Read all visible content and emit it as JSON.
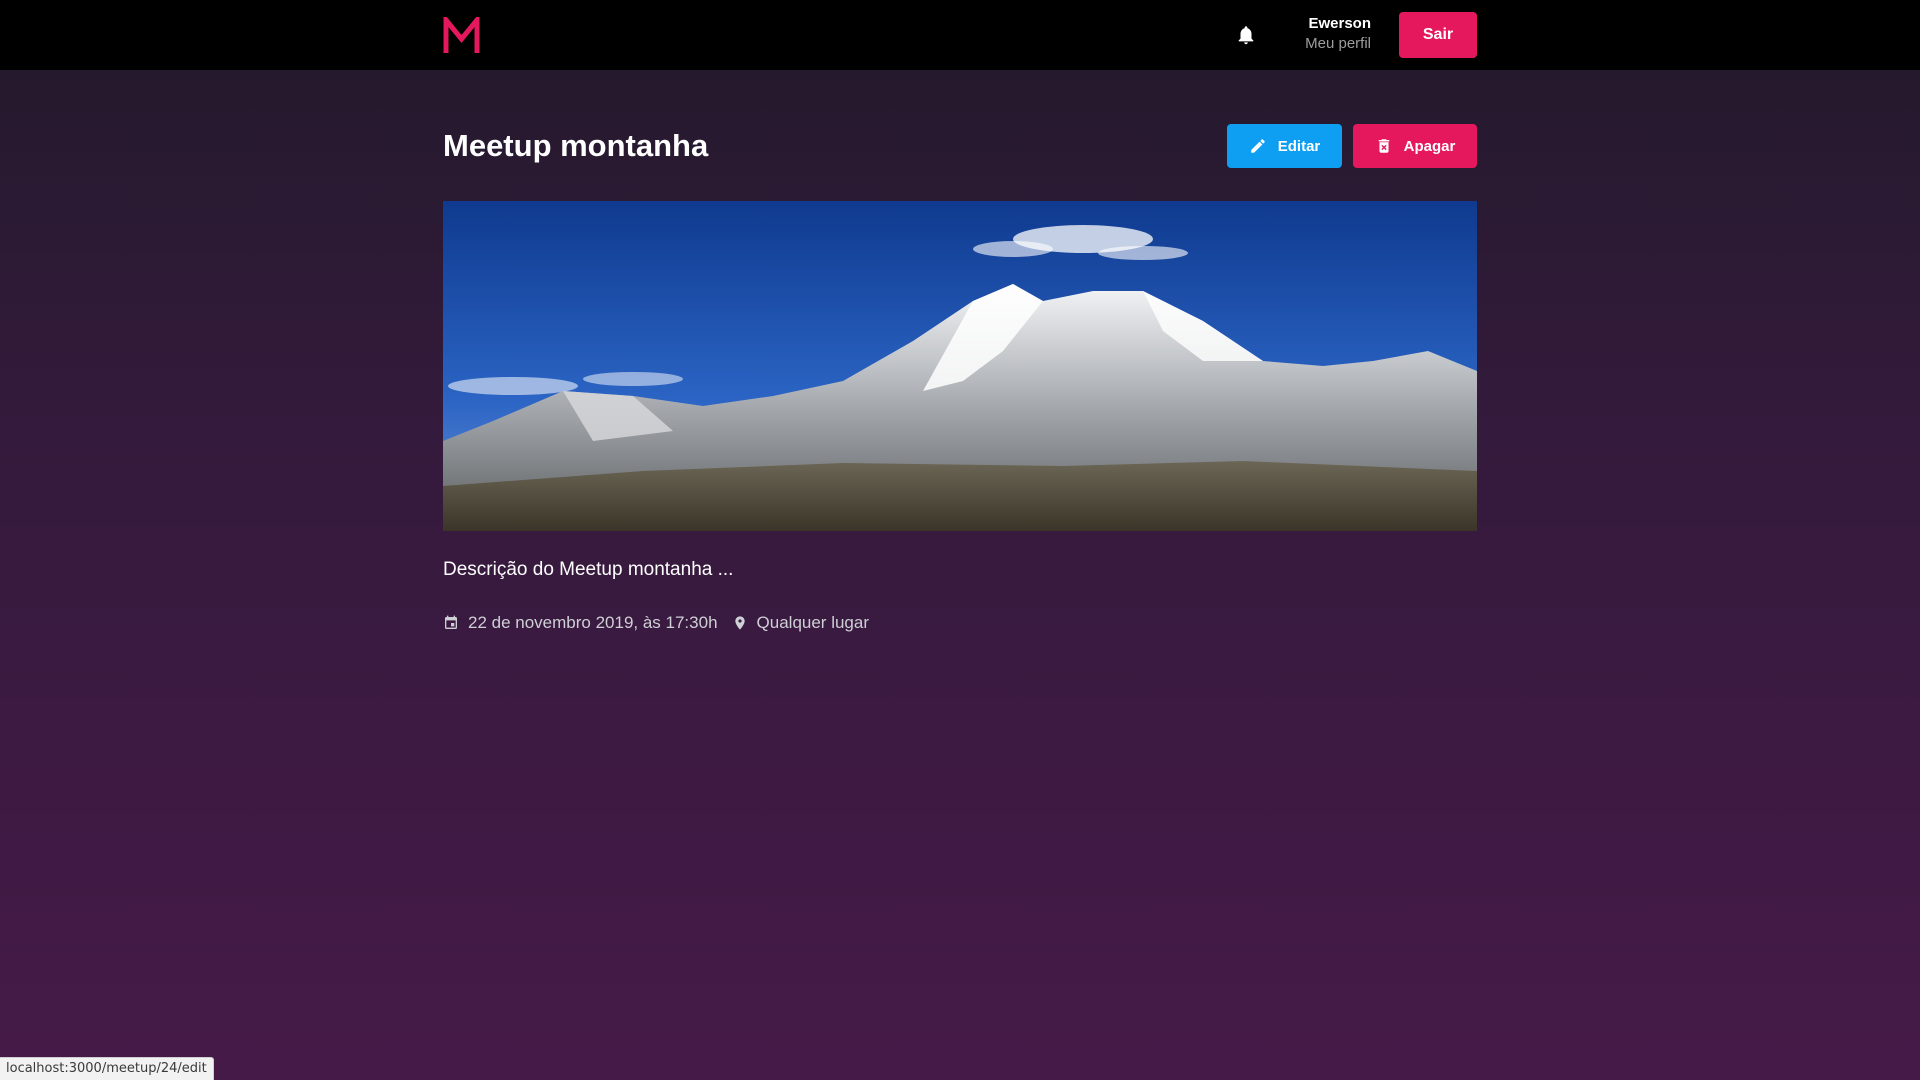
{
  "header": {
    "logo_letter": "M",
    "user_name": "Ewerson",
    "profile_link": "Meu perfil",
    "logout_label": "Sair"
  },
  "meetup": {
    "title": "Meetup montanha",
    "edit_label": "Editar",
    "delete_label": "Apagar",
    "description": "Descrição do Meetup montanha ...",
    "date": "22 de novembro 2019, às 17:30h",
    "location": "Qualquer lugar",
    "banner_alt": "Mountain"
  },
  "status_bar": {
    "url": "localhost:3000/meetup/24/edit"
  },
  "colors": {
    "primary": "#e5185e",
    "edit": "#0f9ff2",
    "header_bg": "#000000"
  },
  "icons": [
    "logo-icon",
    "bell-icon",
    "pencil-icon",
    "trash-icon",
    "calendar-icon",
    "location-icon"
  ]
}
